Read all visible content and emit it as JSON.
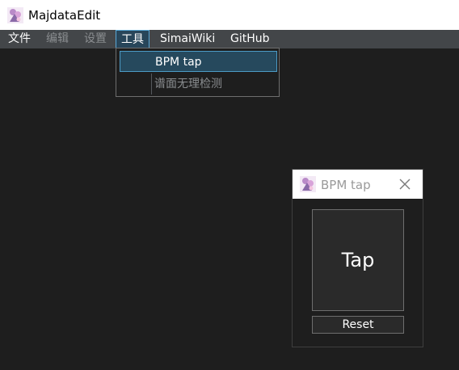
{
  "window": {
    "title": "MajdataEdit",
    "icon": "app-logo-icon"
  },
  "menubar": {
    "items": [
      {
        "label": "文件",
        "state": "enabled"
      },
      {
        "label": "编辑",
        "state": "disabled"
      },
      {
        "label": "设置",
        "state": "disabled"
      },
      {
        "label": "工具",
        "state": "open"
      },
      {
        "label": "SimaiWiki",
        "state": "enabled"
      },
      {
        "label": "GitHub",
        "state": "enabled"
      }
    ]
  },
  "tools_menu": {
    "items": [
      {
        "label": "BPM tap",
        "state": "highlighted"
      },
      {
        "label": "谱面无理检测",
        "state": "disabled"
      }
    ]
  },
  "bpm_window": {
    "title": "BPM tap",
    "close_icon": "close-icon",
    "tap_label": "Tap",
    "reset_label": "Reset"
  },
  "colors": {
    "background": "#1e1e1e",
    "menubar": "#434649",
    "highlight": "#28465a",
    "highlight_border": "#5aa8d6",
    "disabled_text": "#8a8d90"
  }
}
